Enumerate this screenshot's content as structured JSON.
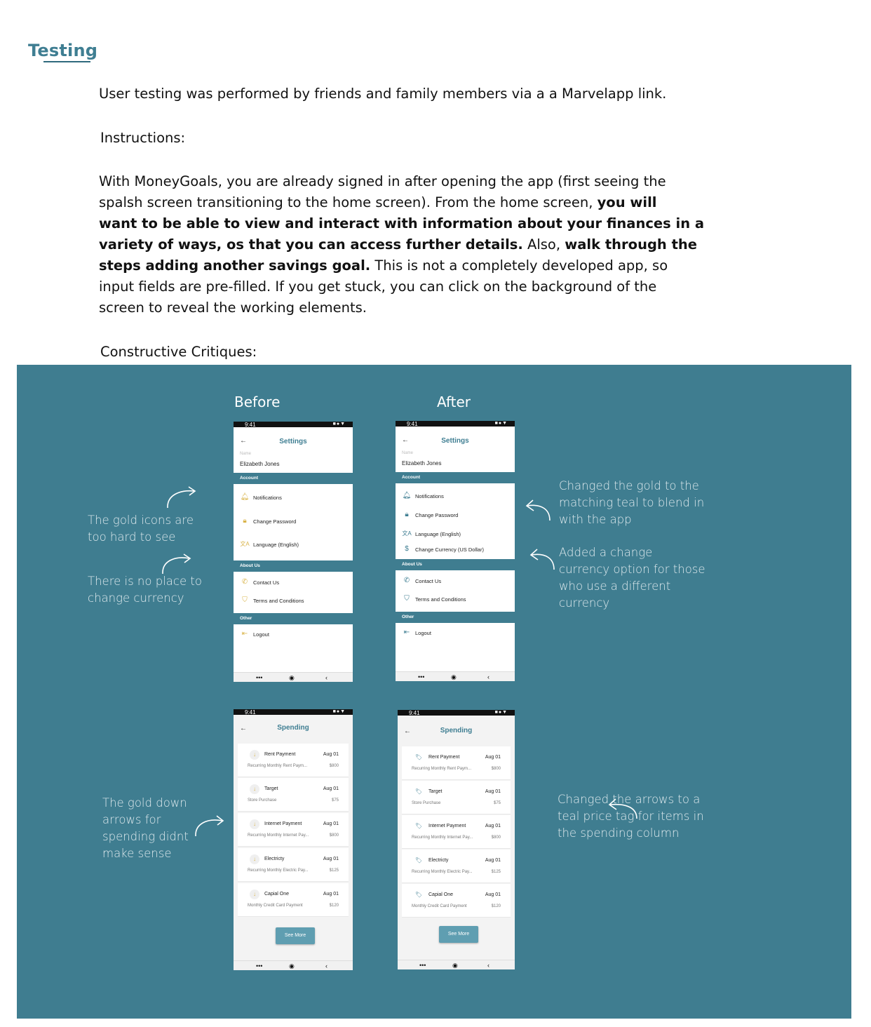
{
  "section_title": "Testing",
  "intro": "User testing was performed by friends and family members via a a Marvelapp link.",
  "instructions_heading": "Instructions:",
  "instructions": {
    "p1": "With MoneyGoals, you are already signed in after opening the app (first seeing the",
    "p2a": "spalsh screen transitioning to the home screen).  From the home screen, ",
    "p2b": "you will",
    "p3": "want to be able to view and interact with information about your finances in a",
    "p4a": "variety of ways, os that you can access further details.",
    "p4b": "  Also, ",
    "p4c": "walk through the",
    "p5a": "steps adding another savings goal.",
    "p5b": "  This is not a completely developed app, so",
    "p6": "input fields are pre-filled. If you get stuck, you can click on the background of the",
    "p7": "screen to reveal the working elements."
  },
  "critiques_heading": "Constructive Critiques:",
  "columns": {
    "before": "Before",
    "after": "After"
  },
  "notes": {
    "gold_icons": [
      "The gold icons are",
      "too hard to see"
    ],
    "no_currency": [
      "There is no place to",
      "change currency"
    ],
    "changed_gold": [
      "Changed the gold to the",
      "matching teal to blend in",
      "with the app"
    ],
    "added_currency": [
      "Added a change",
      "currency option for those",
      "who use a different",
      "currency"
    ],
    "gold_arrows": [
      "The gold down",
      "arrows for",
      "spending didnt",
      "make sense"
    ],
    "changed_arrows": [
      "Changed the arrows to a",
      "teal price tag for items in",
      "the spending column"
    ]
  },
  "phone_common": {
    "time": "9:41",
    "status_icons": "■●▼",
    "back": "←",
    "nav": [
      "•••",
      "◉",
      "‹"
    ]
  },
  "settings": {
    "title": "Settings",
    "name_label": "Name",
    "name_value": "Elizabeth Jones",
    "account": "Account",
    "notifications": "Notifications",
    "change_password": "Change Password",
    "language": "Language (English)",
    "change_currency": "Change Currency (US Dollar)",
    "about_us": "About Us",
    "contact_us": "Contact Us",
    "terms": "Terms and Conditions",
    "other": "Other",
    "logout": "Logout"
  },
  "spending": {
    "title": "Spending",
    "see_more": "See More",
    "items": [
      {
        "title": "Rent Payment",
        "date": "Aug 01",
        "sub_before": "Recurring Monthly Rent Paym...",
        "sub_after": "Recurring Monthly Rent Paym...",
        "amount": "$800"
      },
      {
        "title": "Target",
        "date": "Aug 01",
        "sub_before": "Store Purchase",
        "sub_after": "Store Purchase",
        "amount": "$75"
      },
      {
        "title": "Internet Payment",
        "date": "Aug 01",
        "sub_before": "Recurring Monthly Internet Pay...",
        "sub_after": "Recurring Monthly Internet Pay...",
        "amount": "$800"
      },
      {
        "title": "Electricty",
        "date": "Aug 01",
        "sub_before": "Recurring Monthly Electric Pay...",
        "sub_after": "Recurring Monthly Electric Pay...",
        "amount": "$125"
      },
      {
        "title": "Capial One",
        "date": "Aug 01",
        "sub_before": "Monthly Credit Card Payment",
        "sub_after": "Monthly Credit Card Payment",
        "amount": "$120"
      }
    ]
  },
  "colors": {
    "teal_panel": "#3f7d90",
    "accent_teal": "#3f7e92",
    "gold": "#d9b44a"
  },
  "icons": {
    "bell": "bell-icon",
    "lock": "lock-icon",
    "translate": "translate-icon",
    "dollar": "dollar-icon",
    "phone": "phone-icon",
    "shield": "shield-icon",
    "logout": "logout-icon",
    "arrow_down": "arrow-down-icon",
    "price_tag": "price-tag-icon"
  }
}
